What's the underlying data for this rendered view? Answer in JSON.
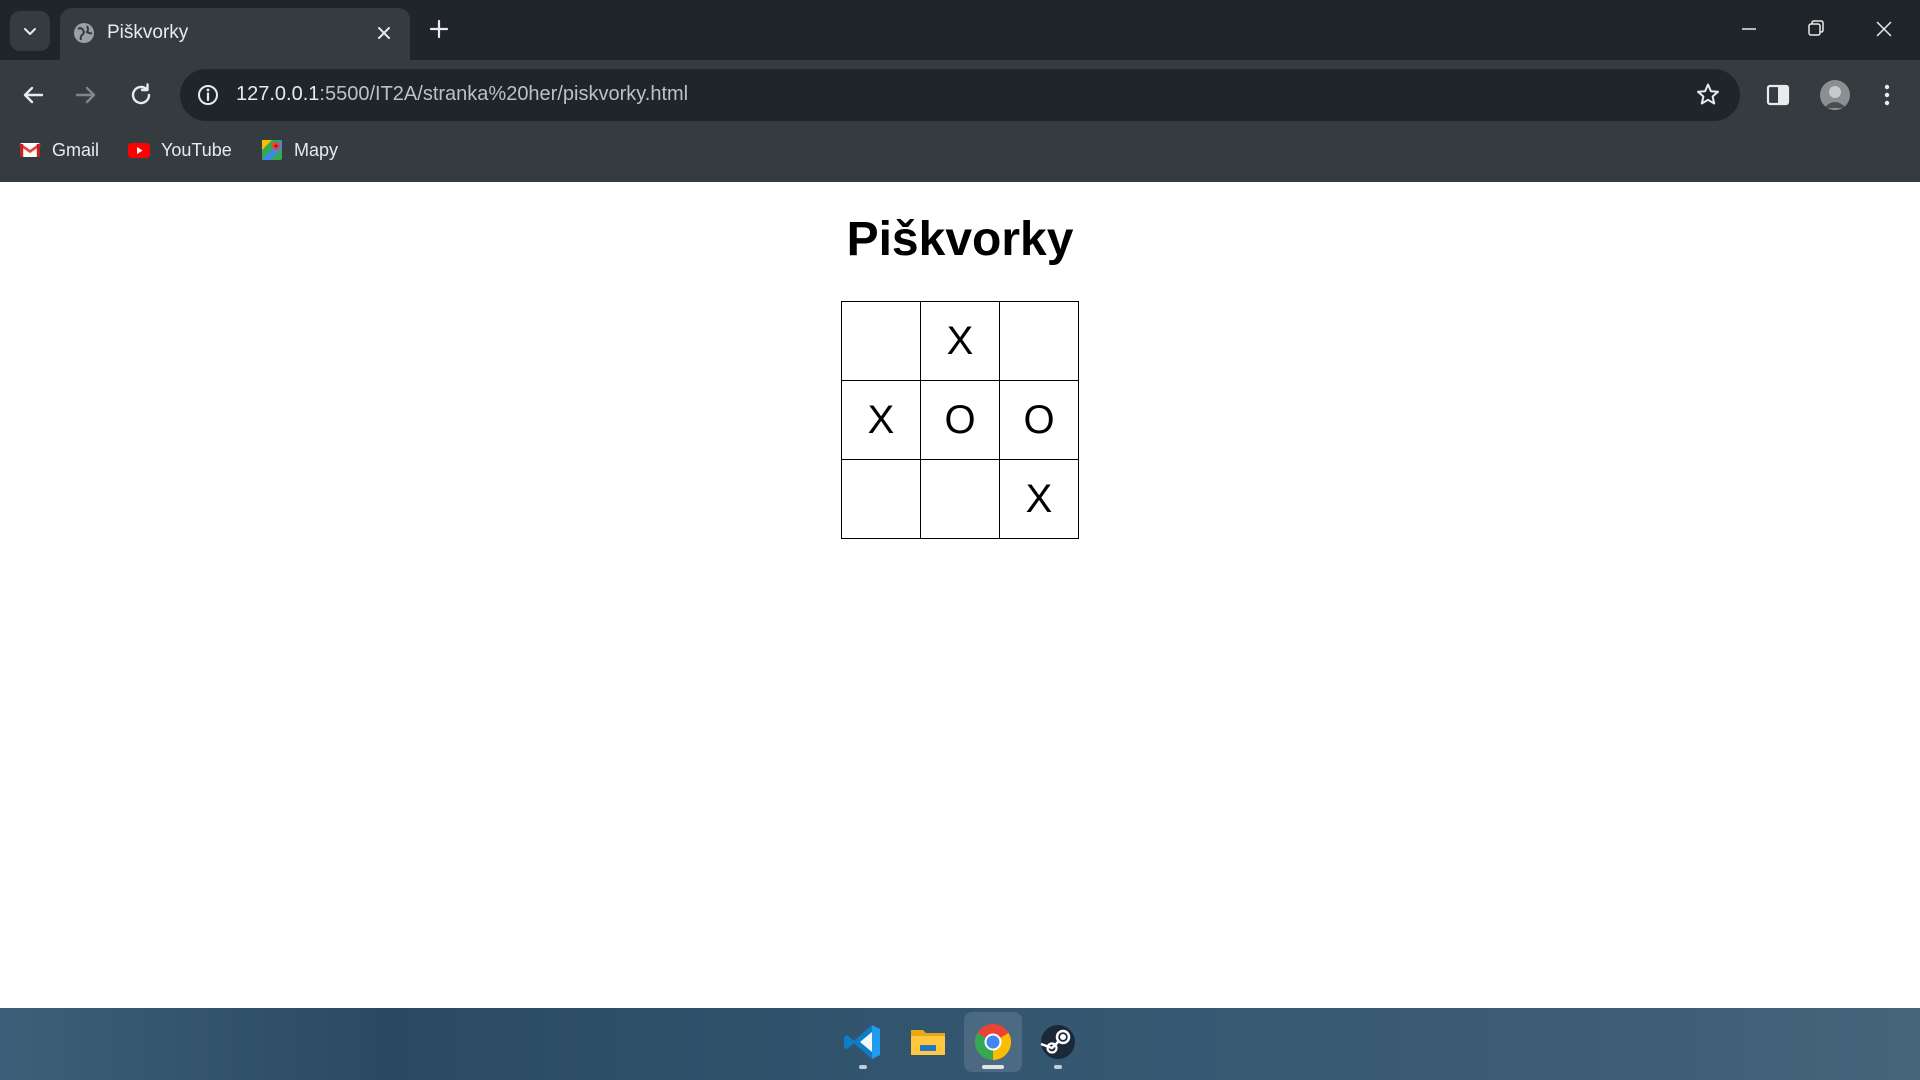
{
  "browser": {
    "tab": {
      "title": "Piškvorky"
    },
    "address_bar": {
      "url_host": "127.0.0.1",
      "url_path": ":5500/IT2A/stranka%20her/piskvorky.html"
    },
    "bookmarks": [
      {
        "label": "Gmail",
        "icon": "gmail-icon"
      },
      {
        "label": "YouTube",
        "icon": "youtube-icon"
      },
      {
        "label": "Mapy",
        "icon": "maps-icon"
      }
    ]
  },
  "page": {
    "title": "Piškvorky",
    "board": [
      [
        "",
        "X",
        ""
      ],
      [
        "X",
        "O",
        "O"
      ],
      [
        "",
        "",
        "X"
      ]
    ]
  },
  "taskbar": {
    "apps": [
      {
        "name": "Visual Studio Code",
        "icon": "vscode-icon",
        "running": true,
        "active": false
      },
      {
        "name": "File Explorer",
        "icon": "folder-icon",
        "running": false,
        "active": false
      },
      {
        "name": "Google Chrome",
        "icon": "chrome-icon",
        "running": true,
        "active": true
      },
      {
        "name": "Steam",
        "icon": "steam-icon",
        "running": true,
        "active": false
      }
    ]
  },
  "colors": {
    "titlebar": "#1f2528",
    "toolbar": "#353c40",
    "omnibox": "#1f2528",
    "page_background": "#ffffff",
    "text_light": "#e8eaed"
  }
}
